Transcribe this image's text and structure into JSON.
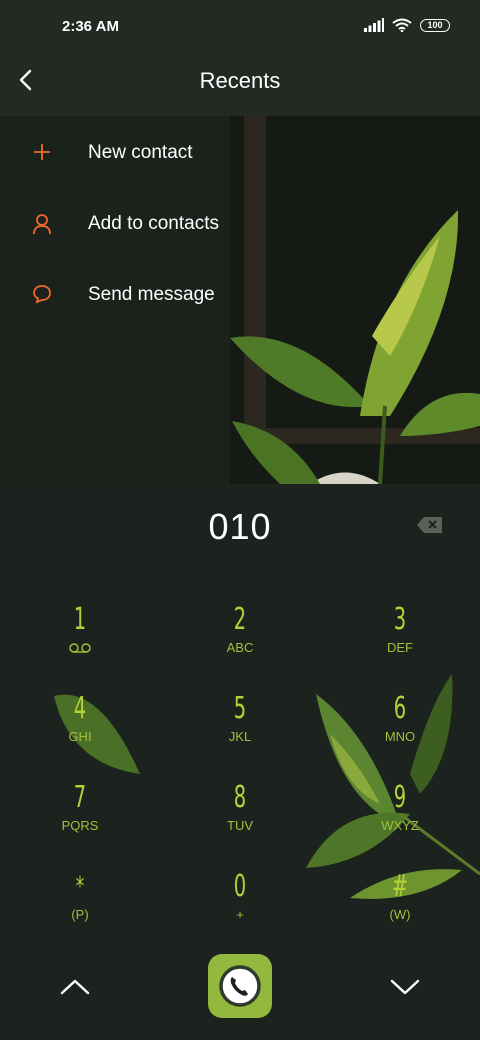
{
  "status_bar": {
    "time": "2:36 AM",
    "battery": "100"
  },
  "header": {
    "title": "Recents"
  },
  "menu": [
    {
      "label": "New contact",
      "icon": "plus-icon"
    },
    {
      "label": "Add to contacts",
      "icon": "person-icon"
    },
    {
      "label": "Send message",
      "icon": "message-icon"
    }
  ],
  "dialer": {
    "number": "010",
    "keys": [
      {
        "digit": "1",
        "letters": ""
      },
      {
        "digit": "2",
        "letters": "ABC"
      },
      {
        "digit": "3",
        "letters": "DEF"
      },
      {
        "digit": "4",
        "letters": "GHI"
      },
      {
        "digit": "5",
        "letters": "JKL"
      },
      {
        "digit": "6",
        "letters": "MNO"
      },
      {
        "digit": "7",
        "letters": "PQRS"
      },
      {
        "digit": "8",
        "letters": "TUV"
      },
      {
        "digit": "9",
        "letters": "WXYZ"
      },
      {
        "digit": "*",
        "letters": "(P)"
      },
      {
        "digit": "0",
        "letters": "+"
      },
      {
        "digit": "#",
        "letters": "(W)"
      }
    ]
  },
  "colors": {
    "accent": "#f06a2a",
    "digit": "#b4d236",
    "call_button": "#92b93d",
    "background": "#1c231e"
  },
  "icons": {
    "back": "back-arrow-icon",
    "voicemail": "voicemail-icon",
    "backspace": "backspace-icon",
    "call": "phone-icon",
    "up": "chevron-up-icon",
    "down": "chevron-down-icon"
  }
}
